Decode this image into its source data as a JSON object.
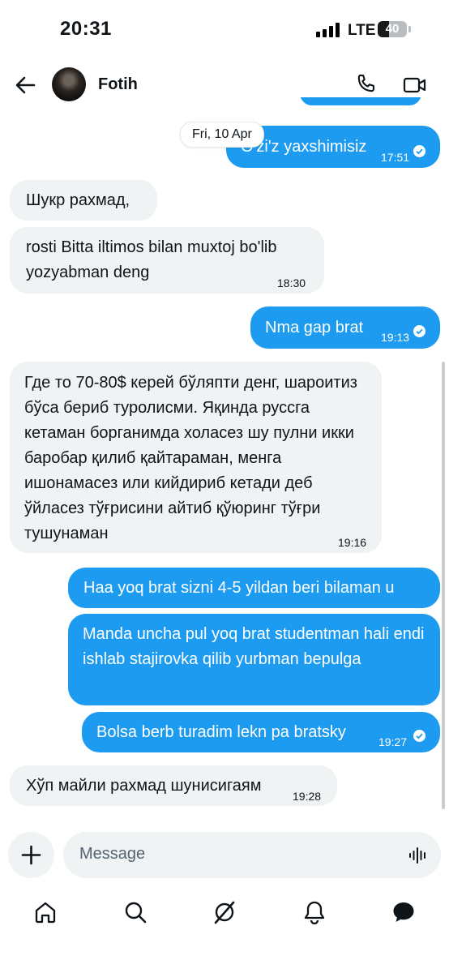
{
  "status_bar": {
    "time": "20:31",
    "network": "LTE",
    "battery": "40",
    "battery_level_percent": 40
  },
  "header": {
    "contact_name": "Fotih"
  },
  "date_separator": "Fri, 10 Apr",
  "messages": [
    {
      "dir": "out",
      "text": "O'zi'z yaxshimisiz",
      "time": "17:51"
    },
    {
      "dir": "in",
      "text": "Шукр рахмад,",
      "time": ""
    },
    {
      "dir": "in",
      "text": "rosti Bitta iltimos bilan muxtoj bo'lib yozyabman deng",
      "time": "18:30"
    },
    {
      "dir": "out",
      "text": "Nma gap brat",
      "time": "19:13"
    },
    {
      "dir": "in",
      "text": "Где то 70-80$ керей бўляпти денг, шароитиз бўса бериб туролисми. Яқинда руссга кетаман борганимда холасез шу пулни икки баробар қилиб қайтараман, менга ишонамасез или кийдириб кетади деб ўйласез тўғрисини айтиб қўюринг тўғри тушунаман",
      "time": "19:16"
    },
    {
      "dir": "out",
      "text": "Haa yoq brat sizni 4-5 yildan beri bilaman u",
      "time": ""
    },
    {
      "dir": "out",
      "text": "Manda uncha pul yoq brat studentman hali endi ishlab stajirovka qilib yurbman bepulga",
      "time": ""
    },
    {
      "dir": "out",
      "text": "Bolsa berb turadim lekn pa bratsky",
      "time": "19:27"
    },
    {
      "dir": "in",
      "text": "Хўп майли рахмад шунисигаям",
      "time": "19:28"
    }
  ],
  "composer": {
    "placeholder": "Message"
  },
  "icons": {
    "back": "arrow-left-icon",
    "phone": "phone-icon",
    "video": "video-camera-icon",
    "plus": "plus-icon",
    "voice": "voice-wave-icon",
    "nav": [
      "home-icon",
      "search-icon",
      "grok-icon",
      "bell-icon",
      "messages-icon"
    ]
  },
  "colors": {
    "outgoing_bubble": "#1d9bf0",
    "incoming_bubble": "#eff3f4",
    "text": "#0f1419",
    "muted": "#536471"
  }
}
